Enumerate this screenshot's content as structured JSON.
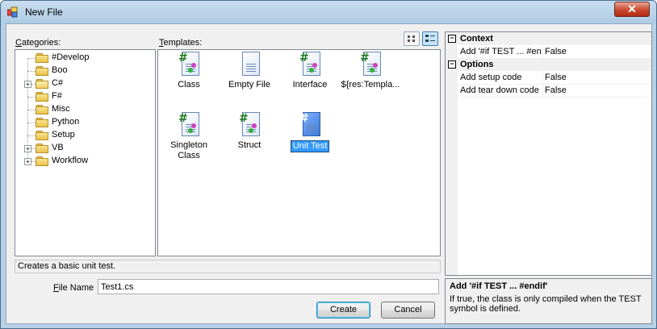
{
  "window": {
    "title": "New File",
    "close_glyph": "✕"
  },
  "categories": {
    "label_u": "C",
    "label_rest": "ategories:",
    "items": [
      {
        "label": "#Develop",
        "expandable": false,
        "open": false
      },
      {
        "label": "Boo",
        "expandable": false,
        "open": false
      },
      {
        "label": "C#",
        "expandable": true,
        "open": true
      },
      {
        "label": "F#",
        "expandable": false,
        "open": false
      },
      {
        "label": "Misc",
        "expandable": false,
        "open": false
      },
      {
        "label": "Python",
        "expandable": false,
        "open": false
      },
      {
        "label": "Setup",
        "expandable": false,
        "open": false
      },
      {
        "label": "VB",
        "expandable": true,
        "open": false
      },
      {
        "label": "Workflow",
        "expandable": true,
        "open": false
      }
    ]
  },
  "templates": {
    "label_u": "T",
    "label_rest": "emplates:",
    "items": [
      {
        "name": "Class",
        "icon": "csharp-file-icon",
        "selected": false
      },
      {
        "name": "Empty File",
        "icon": "empty-file-icon",
        "selected": false
      },
      {
        "name": "Interface",
        "icon": "csharp-file-icon",
        "selected": false
      },
      {
        "name": "${res:Templa...",
        "icon": "csharp-file-icon",
        "selected": false
      },
      {
        "name": "Singleton Class",
        "icon": "csharp-file-icon",
        "selected": false
      },
      {
        "name": "Struct",
        "icon": "csharp-file-icon",
        "selected": false
      },
      {
        "name": "Unit Test",
        "icon": "unit-test-file-icon",
        "selected": true
      }
    ]
  },
  "properties": {
    "categories": [
      {
        "name": "Context",
        "collapse_glyph": "−",
        "rows": [
          {
            "name": "Add '#if TEST ... #endif'",
            "value": "False"
          }
        ]
      },
      {
        "name": "Options",
        "collapse_glyph": "−",
        "rows": [
          {
            "name": "Add setup code",
            "value": "False"
          },
          {
            "name": "Add tear down code",
            "value": "False"
          }
        ]
      }
    ],
    "description_title": "Add '#if TEST ... #endif'",
    "description_text": "If true, the class is only compiled when the TEST symbol is defined."
  },
  "status_text": "Creates a basic unit test.",
  "filename": {
    "label_u": "F",
    "label_rest": "ile Name",
    "value": "Test1.cs"
  },
  "buttons": {
    "create": "Create",
    "cancel": "Cancel"
  },
  "colors": {
    "selection": "#3399ff",
    "accent": "#3c7fb1",
    "close": "#c9492f"
  }
}
